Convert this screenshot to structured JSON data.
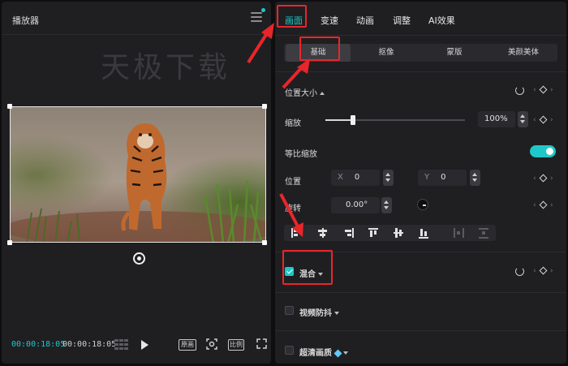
{
  "player": {
    "title": "播放器",
    "watermark": "天极下载",
    "time_current": "00:00:18:05",
    "time_total": "00:00:18:05",
    "btn_original": "原画",
    "btn_ratio": "比例"
  },
  "tabs": [
    "画面",
    "变速",
    "动画",
    "调整",
    "AI效果"
  ],
  "active_tab": "画面",
  "subtabs": [
    "基础",
    "抠像",
    "蒙版",
    "美颜美体"
  ],
  "active_subtab": "基础",
  "props": {
    "section_title": "位置大小",
    "scale_label": "缩放",
    "scale_value": "100%",
    "scale_fraction": 0.2,
    "uniform_label": "等比缩放",
    "uniform_on": true,
    "position_label": "位置",
    "pos_x_prefix": "X",
    "pos_x_value": "0",
    "pos_y_prefix": "Y",
    "pos_y_value": "0",
    "rotate_label": "旋转",
    "rotate_value": "0.00°"
  },
  "sections": {
    "blend_label": "混合",
    "blend_checked": true,
    "stabilize_label": "视频防抖",
    "stabilize_checked": false,
    "hd_label": "超清画质",
    "hd_checked": false
  },
  "colors": {
    "accent": "#1ec8c8",
    "highlight_red": "#e8262a",
    "panel_bg": "#1f1f22"
  }
}
